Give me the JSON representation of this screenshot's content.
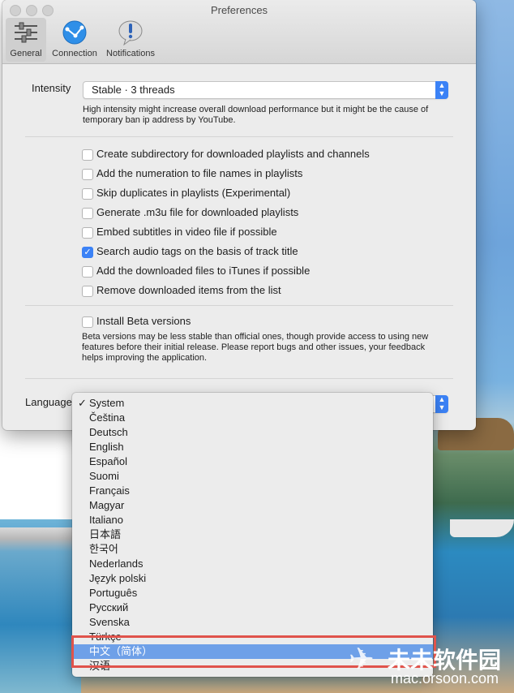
{
  "window": {
    "title": "Preferences",
    "toolbar": [
      {
        "label": "General",
        "icon": "sliders-icon",
        "selected": true
      },
      {
        "label": "Connection",
        "icon": "globe-icon",
        "selected": false
      },
      {
        "label": "Notifications",
        "icon": "exclamation-bubble-icon",
        "selected": false
      }
    ]
  },
  "general": {
    "intensity_label": "Intensity",
    "intensity_value": "Stable · 3 threads",
    "intensity_help": "High intensity might increase overall download performance but it might be the cause of temporary ban ip address by YouTube.",
    "options": [
      {
        "label": "Create subdirectory for downloaded playlists and channels",
        "checked": false
      },
      {
        "label": "Add the numeration to file names in playlists",
        "checked": false
      },
      {
        "label": "Skip duplicates in playlists (Experimental)",
        "checked": false
      },
      {
        "label": "Generate .m3u file for downloaded playlists",
        "checked": false
      },
      {
        "label": "Embed subtitles in video file if possible",
        "checked": false
      },
      {
        "label": "Search audio tags on the basis of track title",
        "checked": true
      },
      {
        "label": "Add the downloaded files to iTunes if possible",
        "checked": false
      },
      {
        "label": "Remove downloaded items from the list",
        "checked": false
      }
    ],
    "beta_label": "Install Beta versions",
    "beta_checked": false,
    "beta_help": "Beta versions may be less stable than official ones, though provide access to using new features before their initial release. Please report bugs and other issues, your feedback helps improving the application.",
    "language_label": "Language"
  },
  "language_menu": {
    "checkmark": "✓",
    "items": [
      "System",
      "Čeština",
      "Deutsch",
      "English",
      "Español",
      "Suomi",
      "Français",
      "Magyar",
      "Italiano",
      "日本語",
      "한국어",
      "Nederlands",
      "Język polski",
      "Português",
      "Русский",
      "Svenska",
      "Türkçe",
      "中文（简体）",
      "汉语"
    ],
    "selected": "System",
    "highlighted": "中文（简体）"
  },
  "watermark": {
    "logo": "✈",
    "text": "未未软件园",
    "url": "mac.orsoon.com"
  },
  "colors": {
    "accent": "#3b82f6",
    "highlight": "#6ea0e8",
    "annotation": "#e0534b"
  }
}
